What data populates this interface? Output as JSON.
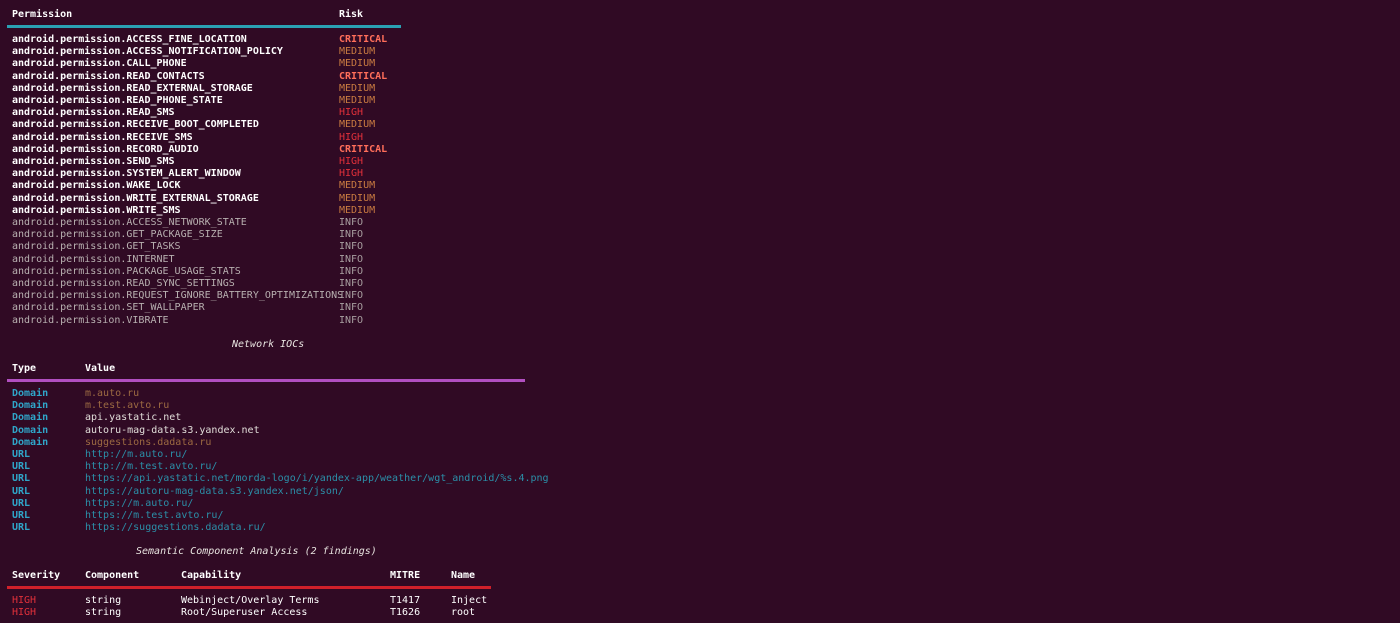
{
  "permissions_table": {
    "headers": {
      "permission": "Permission",
      "risk": "Risk"
    },
    "accent_color": "#2aa1b3",
    "rows": [
      {
        "name": "android.permission.ACCESS_FINE_LOCATION",
        "risk": "CRITICAL",
        "level": "critical"
      },
      {
        "name": "android.permission.ACCESS_NOTIFICATION_POLICY",
        "risk": "MEDIUM",
        "level": "medium"
      },
      {
        "name": "android.permission.CALL_PHONE",
        "risk": "MEDIUM",
        "level": "medium"
      },
      {
        "name": "android.permission.READ_CONTACTS",
        "risk": "CRITICAL",
        "level": "critical"
      },
      {
        "name": "android.permission.READ_EXTERNAL_STORAGE",
        "risk": "MEDIUM",
        "level": "medium"
      },
      {
        "name": "android.permission.READ_PHONE_STATE",
        "risk": "MEDIUM",
        "level": "medium"
      },
      {
        "name": "android.permission.READ_SMS",
        "risk": "HIGH",
        "level": "high"
      },
      {
        "name": "android.permission.RECEIVE_BOOT_COMPLETED",
        "risk": "MEDIUM",
        "level": "medium"
      },
      {
        "name": "android.permission.RECEIVE_SMS",
        "risk": "HIGH",
        "level": "high"
      },
      {
        "name": "android.permission.RECORD_AUDIO",
        "risk": "CRITICAL",
        "level": "critical"
      },
      {
        "name": "android.permission.SEND_SMS",
        "risk": "HIGH",
        "level": "high"
      },
      {
        "name": "android.permission.SYSTEM_ALERT_WINDOW",
        "risk": "HIGH",
        "level": "high"
      },
      {
        "name": "android.permission.WAKE_LOCK",
        "risk": "MEDIUM",
        "level": "medium"
      },
      {
        "name": "android.permission.WRITE_EXTERNAL_STORAGE",
        "risk": "MEDIUM",
        "level": "medium"
      },
      {
        "name": "android.permission.WRITE_SMS",
        "risk": "MEDIUM",
        "level": "medium"
      },
      {
        "name": "android.permission.ACCESS_NETWORK_STATE",
        "risk": "INFO",
        "level": "info"
      },
      {
        "name": "android.permission.GET_PACKAGE_SIZE",
        "risk": "INFO",
        "level": "info"
      },
      {
        "name": "android.permission.GET_TASKS",
        "risk": "INFO",
        "level": "info"
      },
      {
        "name": "android.permission.INTERNET",
        "risk": "INFO",
        "level": "info"
      },
      {
        "name": "android.permission.PACKAGE_USAGE_STATS",
        "risk": "INFO",
        "level": "info"
      },
      {
        "name": "android.permission.READ_SYNC_SETTINGS",
        "risk": "INFO",
        "level": "info"
      },
      {
        "name": "android.permission.REQUEST_IGNORE_BATTERY_OPTIMIZATIONS",
        "risk": "INFO",
        "level": "info"
      },
      {
        "name": "android.permission.SET_WALLPAPER",
        "risk": "INFO",
        "level": "info"
      },
      {
        "name": "android.permission.VIBRATE",
        "risk": "INFO",
        "level": "info"
      }
    ]
  },
  "network_iocs": {
    "title": "Network IOCs",
    "headers": {
      "type": "Type",
      "value": "Value"
    },
    "accent_color": "#b14fc0",
    "rows": [
      {
        "type": "Domain",
        "value": "m.auto.ru",
        "style": "orange"
      },
      {
        "type": "Domain",
        "value": "m.test.avto.ru",
        "style": "orange"
      },
      {
        "type": "Domain",
        "value": "api.yastatic.net",
        "style": "plain"
      },
      {
        "type": "Domain",
        "value": "autoru-mag-data.s3.yandex.net",
        "style": "plain"
      },
      {
        "type": "Domain",
        "value": "suggestions.dadata.ru",
        "style": "orange"
      },
      {
        "type": "URL",
        "value": "http://m.auto.ru/",
        "style": "url"
      },
      {
        "type": "URL",
        "value": "http://m.test.avto.ru/",
        "style": "url"
      },
      {
        "type": "URL",
        "value": "https://api.yastatic.net/morda-logo/i/yandex-app/weather/wgt_android/%s.4.png",
        "style": "url"
      },
      {
        "type": "URL",
        "value": "https://autoru-mag-data.s3.yandex.net/json/",
        "style": "url"
      },
      {
        "type": "URL",
        "value": "https://m.auto.ru/",
        "style": "url"
      },
      {
        "type": "URL",
        "value": "https://m.test.avto.ru/",
        "style": "url"
      },
      {
        "type": "URL",
        "value": "https://suggestions.dadata.ru/",
        "style": "url"
      }
    ]
  },
  "semantic_analysis": {
    "title": "Semantic Component Analysis (2 findings)",
    "headers": {
      "severity": "Severity",
      "component": "Component",
      "capability": "Capability",
      "mitre": "MITRE",
      "name": "Name"
    },
    "accent_color": "#d0202a",
    "rows": [
      {
        "severity": "HIGH",
        "component": "string",
        "capability": "Webinject/Overlay Terms",
        "mitre": "T1417",
        "name": "Inject"
      },
      {
        "severity": "HIGH",
        "component": "string",
        "capability": "Root/Superuser Access",
        "mitre": "T1626",
        "name": "root"
      }
    ]
  }
}
